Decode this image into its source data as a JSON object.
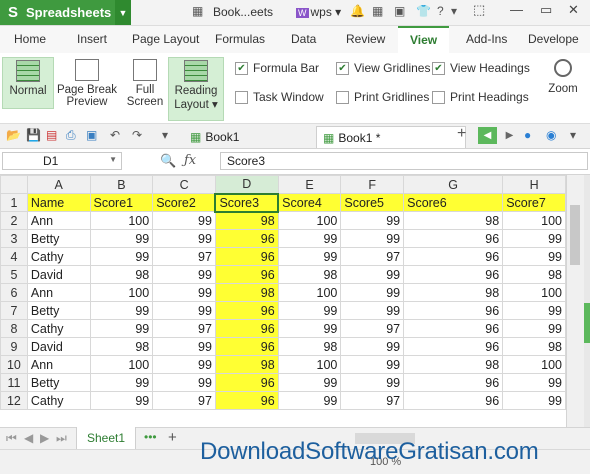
{
  "app": {
    "name": "Spreadsheets",
    "doc_title": "Book...eets",
    "wps_label": "wps"
  },
  "menu": {
    "tabs": [
      "Home",
      "Insert",
      "Page Layout",
      "Formulas",
      "Data",
      "Review",
      "View",
      "Add-Ins",
      "Develope"
    ],
    "active": "View"
  },
  "ribbon": {
    "normal": "Normal",
    "page_break_1": "Page Break",
    "page_break_2": "Preview",
    "full_1": "Full",
    "full_2": "Screen",
    "reading_1": "Reading",
    "reading_2": "Layout",
    "formula_bar": "Formula Bar",
    "task_window": "Task Window",
    "view_gridlines": "View Gridlines",
    "print_gridlines": "Print Gridlines",
    "view_headings": "View Headings",
    "print_headings": "Print Headings",
    "zoom": "Zoom"
  },
  "doc_tabs": {
    "tab1": "Book1",
    "tab2": "Book1 *"
  },
  "formula": {
    "name_box": "D1",
    "content": "Score3"
  },
  "grid": {
    "columns": [
      "A",
      "B",
      "C",
      "D",
      "E",
      "F",
      "G",
      "H"
    ],
    "rows": [
      [
        "1",
        "Name",
        "Score1",
        "Score2",
        "Score3",
        "Score4",
        "Score5",
        "Score6",
        "Score7"
      ],
      [
        "2",
        "Ann",
        "100",
        "99",
        "98",
        "100",
        "99",
        "98",
        "100"
      ],
      [
        "3",
        "Betty",
        "99",
        "99",
        "96",
        "99",
        "99",
        "96",
        "99"
      ],
      [
        "4",
        "Cathy",
        "99",
        "97",
        "96",
        "99",
        "97",
        "96",
        "99"
      ],
      [
        "5",
        "David",
        "98",
        "99",
        "96",
        "98",
        "99",
        "96",
        "98"
      ],
      [
        "6",
        "Ann",
        "100",
        "99",
        "98",
        "100",
        "99",
        "98",
        "100"
      ],
      [
        "7",
        "Betty",
        "99",
        "99",
        "96",
        "99",
        "99",
        "96",
        "99"
      ],
      [
        "8",
        "Cathy",
        "99",
        "97",
        "96",
        "99",
        "97",
        "96",
        "99"
      ],
      [
        "9",
        "David",
        "98",
        "99",
        "96",
        "98",
        "99",
        "96",
        "98"
      ],
      [
        "10",
        "Ann",
        "100",
        "99",
        "98",
        "100",
        "99",
        "98",
        "100"
      ],
      [
        "11",
        "Betty",
        "99",
        "99",
        "96",
        "99",
        "99",
        "96",
        "99"
      ],
      [
        "12",
        "Cathy",
        "99",
        "97",
        "96",
        "99",
        "97",
        "96",
        "99"
      ]
    ]
  },
  "sheets": {
    "active": "Sheet1"
  },
  "status": {
    "zoom": "100 %"
  },
  "watermark": "DownloadSoftwareGratisan.com",
  "colors": {
    "accent": "#3f9a3f",
    "highlight": "#ffff33"
  }
}
